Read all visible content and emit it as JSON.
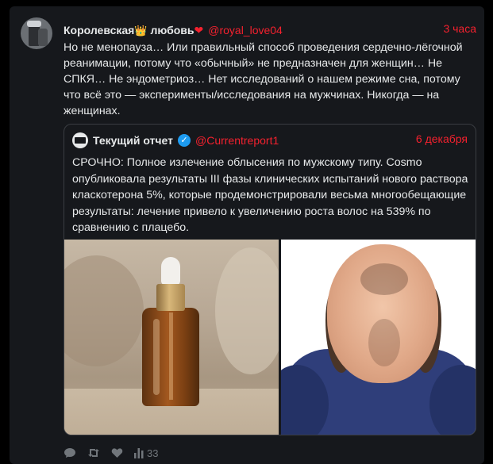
{
  "post": {
    "author_name": "Королевская",
    "author_name_emoji": "👑",
    "author_name_suffix": "любовь",
    "author_heart": "❤",
    "handle": "@royal_love04",
    "time": "3 часа",
    "text": "Но не менопауза… Или правильный способ проведения сердечно-лёгочной реанимации, потому что «обычный» не предназначен для женщин… Не СПКЯ… Не эндометриоз… Нет исследований о нашем режиме сна, потому что всё это — эксперименты/исследования на мужчинах. Никогда — на женщинах."
  },
  "quote": {
    "author_name": "Текущий отчет",
    "verified_mark": "✓",
    "handle": "@Currentreport1",
    "date": "6 декабря",
    "text": "СРОЧНО: Полное излечение облысения по мужскому типу. Cosmo опубликовала результаты III фазы клинических испытаний нового раствора класкотерона 5%, которые продемонстрировали весьма многообещающие результаты: лечение привело к увеличению роста волос на 539% по сравнению с плацебо."
  },
  "actions": {
    "views_count": "33"
  },
  "colors": {
    "accent": "#f4212e",
    "verified": "#1d9bf0",
    "background": "#16181c",
    "muted": "#71767b"
  },
  "icons": [
    "comment-icon",
    "retweet-icon",
    "like-icon",
    "views-icon"
  ]
}
